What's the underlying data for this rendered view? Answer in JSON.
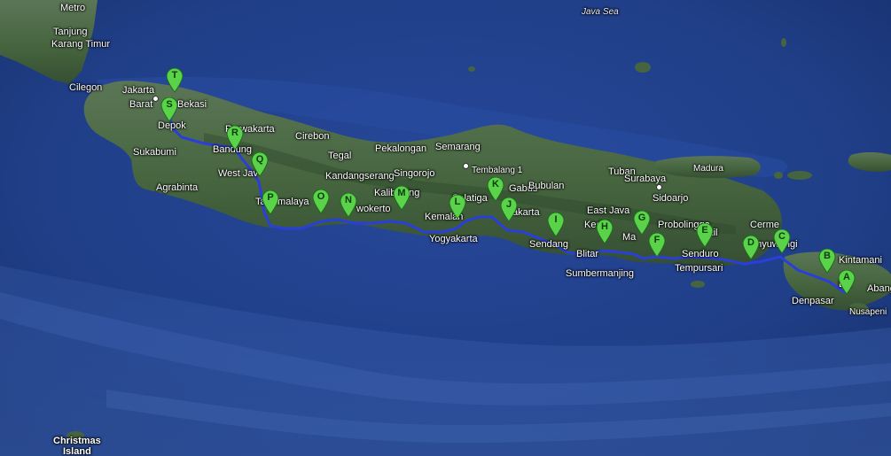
{
  "map": {
    "type": "satellite",
    "colors": {
      "sea": "#1f3f86",
      "deep_sea": "#2d4f9c",
      "land": "#4a6a48",
      "land_dark": "#3a5a3a",
      "route": "#2a3fd9",
      "marker": "#5ad24a",
      "marker_stroke": "#1d6a1d"
    },
    "sea_labels": [
      {
        "id": "java-sea",
        "text": "Java Sea"
      }
    ],
    "places": [
      {
        "id": "metro",
        "text": "Metro"
      },
      {
        "id": "tanjung",
        "text": "Tanjung"
      },
      {
        "id": "karang-timur",
        "text": "Karang Timur"
      },
      {
        "id": "cilegon",
        "text": "Cilegon"
      },
      {
        "id": "jakarta",
        "text": "Jakarta"
      },
      {
        "id": "barat",
        "text": "Barat"
      },
      {
        "id": "bekasi",
        "text": "Bekasi"
      },
      {
        "id": "depok",
        "text": "Depok"
      },
      {
        "id": "purwakarta",
        "text": "Purwakarta"
      },
      {
        "id": "cirebon",
        "text": "Cirebon"
      },
      {
        "id": "sukabumi",
        "text": "Sukabumi"
      },
      {
        "id": "bandung",
        "text": "Bandung"
      },
      {
        "id": "west-java",
        "text": "West Jav"
      },
      {
        "id": "tegal",
        "text": "Tegal"
      },
      {
        "id": "pekalongan",
        "text": "Pekalongan"
      },
      {
        "id": "semarang",
        "text": "Semarang"
      },
      {
        "id": "tembalang",
        "text": "Tembalang 1"
      },
      {
        "id": "kandangserang",
        "text": "Kandangserang"
      },
      {
        "id": "singorojo",
        "text": "Singorojo"
      },
      {
        "id": "agrabinta",
        "text": "Agrabinta"
      },
      {
        "id": "tasikmalaya",
        "text": "Tasikmalaya"
      },
      {
        "id": "kalibening",
        "text": "Kalibening"
      },
      {
        "id": "purwokerto",
        "text": "wokerto"
      },
      {
        "id": "salatiga",
        "text": "Salatiga"
      },
      {
        "id": "gabus",
        "text": "Gabus"
      },
      {
        "id": "kemalang",
        "text": "Kemalan"
      },
      {
        "id": "yogyakarta",
        "text": "Yogyakarta"
      },
      {
        "id": "surakarta",
        "text": "akarta"
      },
      {
        "id": "bubulan",
        "text": "Bubulan"
      },
      {
        "id": "tuban",
        "text": "Tuban"
      },
      {
        "id": "surabaya",
        "text": "Surabaya"
      },
      {
        "id": "tuban-bay",
        "text": "Tuban"
      },
      {
        "id": "madura",
        "text": "Madura"
      },
      {
        "id": "sidoarjo",
        "text": "Sidoarjo"
      },
      {
        "id": "east-java",
        "text": "East Java"
      },
      {
        "id": "kediri",
        "text": "Kediri"
      },
      {
        "id": "probolinggo",
        "text": "Probolinggo"
      },
      {
        "id": "sendang",
        "text": "Sendang"
      },
      {
        "id": "blitar",
        "text": "Blitar"
      },
      {
        "id": "malang",
        "text": "Ma"
      },
      {
        "id": "senduro",
        "text": "Senduro"
      },
      {
        "id": "besuki",
        "text": "ukil"
      },
      {
        "id": "cerme",
        "text": "Cerme"
      },
      {
        "id": "banyuwangi",
        "text": "anyuwangi"
      },
      {
        "id": "sumbermanjing",
        "text": "Sumbermanjing"
      },
      {
        "id": "tempursari",
        "text": "Tempursari"
      },
      {
        "id": "kintamani",
        "text": "Kintamani"
      },
      {
        "id": "bali",
        "text": "Ba"
      },
      {
        "id": "abang",
        "text": "Abang"
      },
      {
        "id": "denpasar",
        "text": "Denpasar"
      },
      {
        "id": "nusapenida",
        "text": "Nusapeni"
      },
      {
        "id": "christmas-island",
        "text": "Christmas\nIsland"
      }
    ],
    "markers": [
      "A",
      "B",
      "C",
      "D",
      "E",
      "F",
      "G",
      "H",
      "I",
      "J",
      "K",
      "L",
      "M",
      "N",
      "O",
      "P",
      "Q",
      "R",
      "S",
      "T"
    ]
  }
}
